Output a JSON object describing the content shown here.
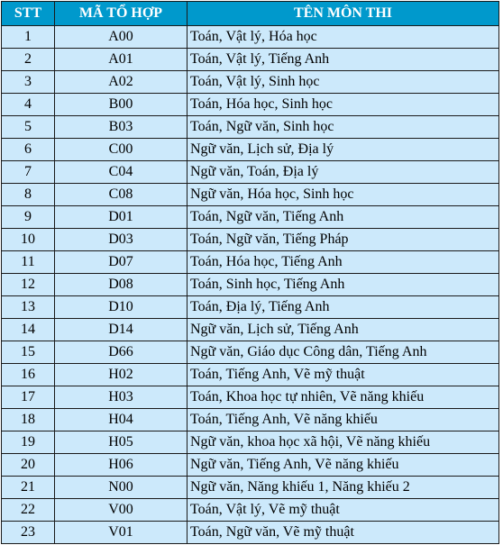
{
  "headers": {
    "stt": "STT",
    "code": "MÃ TỔ HỢP",
    "subjects": "TÊN MÔN THI"
  },
  "colors": {
    "header_bg": "#0099cc",
    "row_bg": "#cce9fb"
  },
  "rows": [
    {
      "stt": "1",
      "code": "A00",
      "subjects": "Toán, Vật lý, Hóa học"
    },
    {
      "stt": "2",
      "code": "A01",
      "subjects": "Toán, Vật lý, Tiếng Anh"
    },
    {
      "stt": "3",
      "code": "A02",
      "subjects": "Toán, Vật lý, Sinh học"
    },
    {
      "stt": "4",
      "code": "B00",
      "subjects": "Toán, Hóa học, Sinh học"
    },
    {
      "stt": "5",
      "code": "B03",
      "subjects": "Toán, Ngữ văn, Sinh học"
    },
    {
      "stt": "6",
      "code": "C00",
      "subjects": "Ngữ văn, Lịch sử, Địa lý"
    },
    {
      "stt": "7",
      "code": "C04",
      "subjects": "Ngữ văn, Toán, Địa lý"
    },
    {
      "stt": "8",
      "code": "C08",
      "subjects": "Ngữ văn, Hóa học, Sinh học"
    },
    {
      "stt": "9",
      "code": "D01",
      "subjects": "Toán, Ngữ văn, Tiếng Anh"
    },
    {
      "stt": "10",
      "code": "D03",
      "subjects": "Toán, Ngữ văn, Tiếng Pháp"
    },
    {
      "stt": "11",
      "code": "D07",
      "subjects": "Toán, Hóa học, Tiếng Anh"
    },
    {
      "stt": "12",
      "code": "D08",
      "subjects": "Toán, Sinh học, Tiếng Anh"
    },
    {
      "stt": "13",
      "code": "D10",
      "subjects": "Toán, Địa lý, Tiếng Anh"
    },
    {
      "stt": "14",
      "code": "D14",
      "subjects": "Ngữ văn, Lịch sử, Tiếng Anh"
    },
    {
      "stt": "15",
      "code": "D66",
      "subjects": "Ngữ văn, Giáo dục Công dân, Tiếng Anh"
    },
    {
      "stt": "16",
      "code": "H02",
      "subjects": "Toán, Tiếng Anh, Vẽ mỹ thuật"
    },
    {
      "stt": "17",
      "code": "H03",
      "subjects": "Toán, Khoa học tự nhiên, Vẽ năng khiếu"
    },
    {
      "stt": "18",
      "code": "H04",
      "subjects": "Toán, Tiếng Anh, Vẽ năng khiếu"
    },
    {
      "stt": "19",
      "code": "H05",
      "subjects": "Ngữ văn, khoa học xã hội, Vẽ năng khiếu"
    },
    {
      "stt": "20",
      "code": "H06",
      "subjects": "Ngữ văn, Tiếng Anh, Vẽ năng khiếu"
    },
    {
      "stt": "21",
      "code": "N00",
      "subjects": "Ngữ văn, Năng khiếu 1, Năng khiếu 2"
    },
    {
      "stt": "22",
      "code": "V00",
      "subjects": "Toán, Vật lý, Vẽ mỹ thuật"
    },
    {
      "stt": "23",
      "code": "V01",
      "subjects": "Toán, Ngữ văn, Vẽ mỹ thuật"
    }
  ]
}
